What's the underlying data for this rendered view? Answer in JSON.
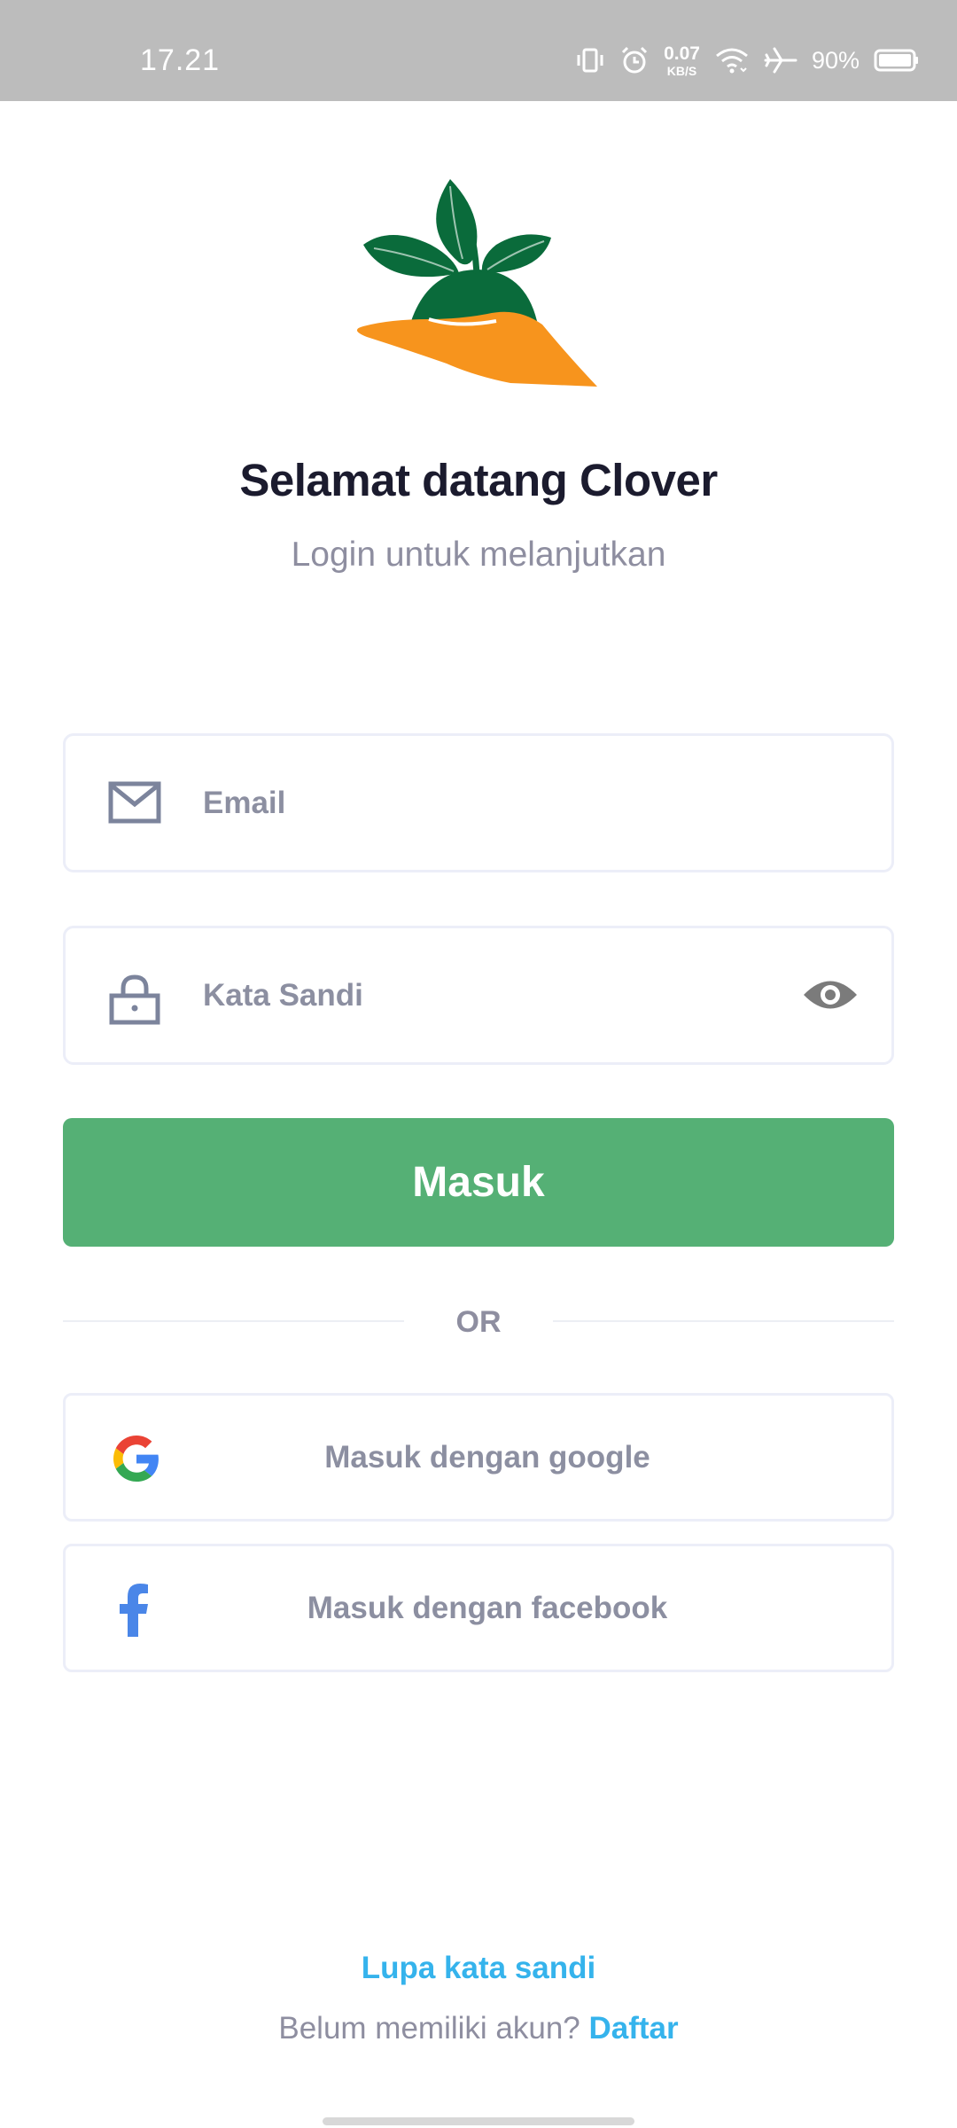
{
  "status_bar": {
    "time": "17.21",
    "net_speed_value": "0.07",
    "net_speed_unit": "KB/S",
    "battery_percent": "90%",
    "icons": [
      "vibrate-icon",
      "alarm-icon",
      "wifi-icon",
      "airplane-mode-icon",
      "battery-icon"
    ]
  },
  "logo": {
    "icon": "plant-in-hand-logo",
    "leaf_color": "#0a6b3b",
    "hand_color": "#f7941d"
  },
  "welcome": {
    "title": "Selamat datang Clover",
    "subtitle": "Login untuk melanjutkan"
  },
  "form": {
    "email": {
      "value": "",
      "placeholder": "Email",
      "icon": "mail-icon"
    },
    "password": {
      "value": "",
      "placeholder": "Kata Sandi",
      "icon": "lock-icon",
      "toggle_icon": "eye-icon"
    },
    "submit_label": "Masuk"
  },
  "divider_label": "OR",
  "social": {
    "google_label": "Masuk dengan google",
    "facebook_label": "Masuk dengan facebook"
  },
  "footer": {
    "forgot_label": "Lupa kata sandi",
    "no_account_text": "Belum memiliki akun? ",
    "register_label": "Daftar"
  },
  "colors": {
    "primary": "#55b075",
    "link": "#35b3ec",
    "muted_text": "#8e8ea0",
    "title_text": "#1b1b2e",
    "border": "#eceef8"
  }
}
